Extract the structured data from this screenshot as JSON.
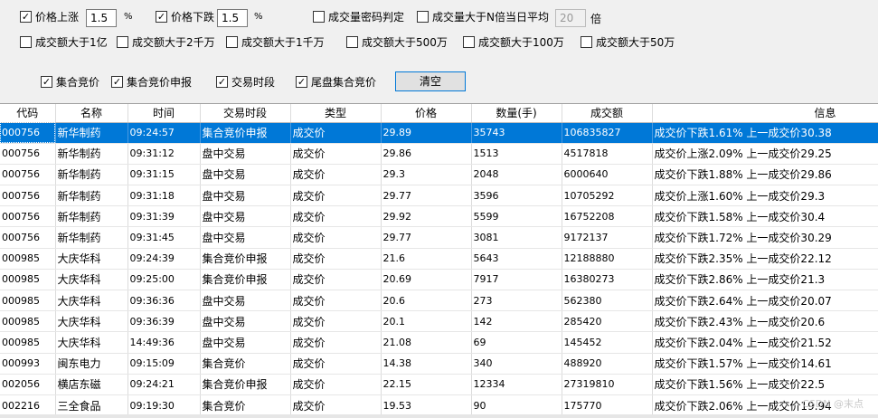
{
  "filters": {
    "row1": [
      {
        "label": "价格上涨",
        "checked": true,
        "value": "1.5",
        "unit": "%"
      },
      {
        "label": "价格下跌",
        "checked": true,
        "value": "1.5",
        "unit": "%"
      },
      {
        "label": "成交量密码判定",
        "checked": false
      },
      {
        "label": "成交量大于N倍当日平均",
        "checked": false,
        "value": "20",
        "unit": "倍"
      }
    ],
    "row2": [
      {
        "label": "成交额大于1亿",
        "checked": false
      },
      {
        "label": "成交额大于2千万",
        "checked": false
      },
      {
        "label": "成交额大于1千万",
        "checked": false
      },
      {
        "label": "成交额大于500万",
        "checked": false
      },
      {
        "label": "成交额大于100万",
        "checked": false
      },
      {
        "label": "成交额大于50万",
        "checked": false
      }
    ],
    "row3": [
      {
        "label": "集合竞价",
        "checked": true
      },
      {
        "label": "集合竞价申报",
        "checked": true
      },
      {
        "label": "交易时段",
        "checked": true
      },
      {
        "label": "尾盘集合竞价",
        "checked": true
      }
    ],
    "clear_button": "清空"
  },
  "table": {
    "columns": [
      "代码",
      "名称",
      "时间",
      "交易时段",
      "类型",
      "价格",
      "数量(手)",
      "成交额",
      "信息"
    ],
    "rows": [
      [
        "000756",
        "新华制药",
        "09:24:57",
        "集合竞价申报",
        "成交价",
        "29.89",
        "35743",
        "106835827",
        "成交价下跌1.61% 上一成交价30.38"
      ],
      [
        "000756",
        "新华制药",
        "09:31:12",
        "盘中交易",
        "成交价",
        "29.86",
        "1513",
        "4517818",
        "成交价上涨2.09% 上一成交价29.25"
      ],
      [
        "000756",
        "新华制药",
        "09:31:15",
        "盘中交易",
        "成交价",
        "29.3",
        "2048",
        "6000640",
        "成交价下跌1.88% 上一成交价29.86"
      ],
      [
        "000756",
        "新华制药",
        "09:31:18",
        "盘中交易",
        "成交价",
        "29.77",
        "3596",
        "10705292",
        "成交价上涨1.60% 上一成交价29.3"
      ],
      [
        "000756",
        "新华制药",
        "09:31:39",
        "盘中交易",
        "成交价",
        "29.92",
        "5599",
        "16752208",
        "成交价下跌1.58% 上一成交价30.4"
      ],
      [
        "000756",
        "新华制药",
        "09:31:45",
        "盘中交易",
        "成交价",
        "29.77",
        "3081",
        "9172137",
        "成交价下跌1.72% 上一成交价30.29"
      ],
      [
        "000985",
        "大庆华科",
        "09:24:39",
        "集合竞价申报",
        "成交价",
        "21.6",
        "5643",
        "12188880",
        "成交价下跌2.35% 上一成交价22.12"
      ],
      [
        "000985",
        "大庆华科",
        "09:25:00",
        "集合竞价申报",
        "成交价",
        "20.69",
        "7917",
        "16380273",
        "成交价下跌2.86% 上一成交价21.3"
      ],
      [
        "000985",
        "大庆华科",
        "09:36:36",
        "盘中交易",
        "成交价",
        "20.6",
        "273",
        "562380",
        "成交价下跌2.64% 上一成交价20.07"
      ],
      [
        "000985",
        "大庆华科",
        "09:36:39",
        "盘中交易",
        "成交价",
        "20.1",
        "142",
        "285420",
        "成交价下跌2.43% 上一成交价20.6"
      ],
      [
        "000985",
        "大庆华科",
        "14:49:36",
        "盘中交易",
        "成交价",
        "21.08",
        "69",
        "145452",
        "成交价下跌2.04% 上一成交价21.52"
      ],
      [
        "000993",
        "闽东电力",
        "09:15:09",
        "集合竞价",
        "成交价",
        "14.38",
        "340",
        "488920",
        "成交价下跌1.57% 上一成交价14.61"
      ],
      [
        "002056",
        "横店东磁",
        "09:24:21",
        "集合竞价申报",
        "成交价",
        "22.15",
        "12334",
        "27319810",
        "成交价下跌1.56% 上一成交价22.5"
      ],
      [
        "002216",
        "三全食品",
        "09:19:30",
        "集合竞价",
        "成交价",
        "19.53",
        "90",
        "175770",
        "成交价下跌2.06% 上一成交价19.94"
      ]
    ],
    "selected_row": 0
  },
  "watermark": "CSDN @末点"
}
